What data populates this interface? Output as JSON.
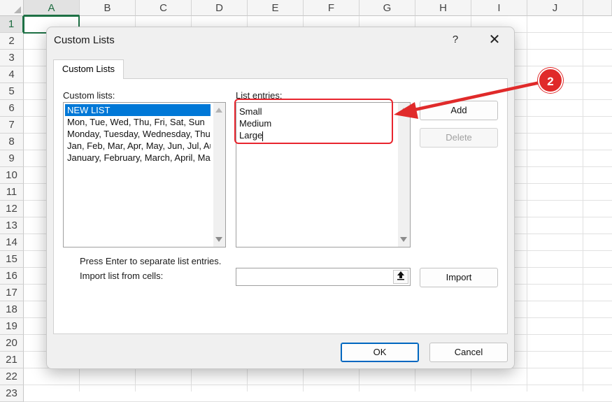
{
  "spreadsheet": {
    "columns": [
      "A",
      "B",
      "C",
      "D",
      "E",
      "F",
      "G",
      "H",
      "I",
      "J"
    ],
    "rows": [
      "1",
      "2",
      "3",
      "4",
      "5",
      "6",
      "7",
      "8",
      "9",
      "10",
      "11",
      "12",
      "13",
      "14",
      "15",
      "16",
      "17",
      "18",
      "19",
      "20",
      "21",
      "22",
      "23"
    ],
    "selected_column": "A",
    "selected_row": "1"
  },
  "dialog": {
    "title": "Custom Lists",
    "help_label": "?",
    "close_label": "✕",
    "tab_label": "Custom Lists",
    "custom_lists_label": "Custom lists:",
    "custom_lists": [
      "NEW LIST",
      "Mon, Tue, Wed, Thu, Fri, Sat, Sun",
      "Monday, Tuesday, Wednesday, Thursday, Friday, Saturday, Sunday",
      "Jan, Feb, Mar, Apr, May, Jun, Jul, Aug, Sep, Oct, Nov, Dec",
      "January, February, March, April, May, June, July, August, September, October, November, December"
    ],
    "selected_list_index": 0,
    "list_entries_label": "List entries:",
    "list_entries": [
      "Small",
      "Medium",
      "Large"
    ],
    "add_label": "Add",
    "delete_label": "Delete",
    "hint_text": "Press Enter to separate list entries.",
    "import_label": "Import list from cells:",
    "import_value": "",
    "collapse_icon": "up-arrow-icon",
    "import_button_label": "Import",
    "ok_label": "OK",
    "cancel_label": "Cancel"
  },
  "annotation": {
    "callout_number": "2",
    "color": "#e02a2a"
  },
  "colors": {
    "selection_blue": "#0078d7",
    "excel_green": "#1e7145",
    "highlight_red": "#e8252e"
  }
}
